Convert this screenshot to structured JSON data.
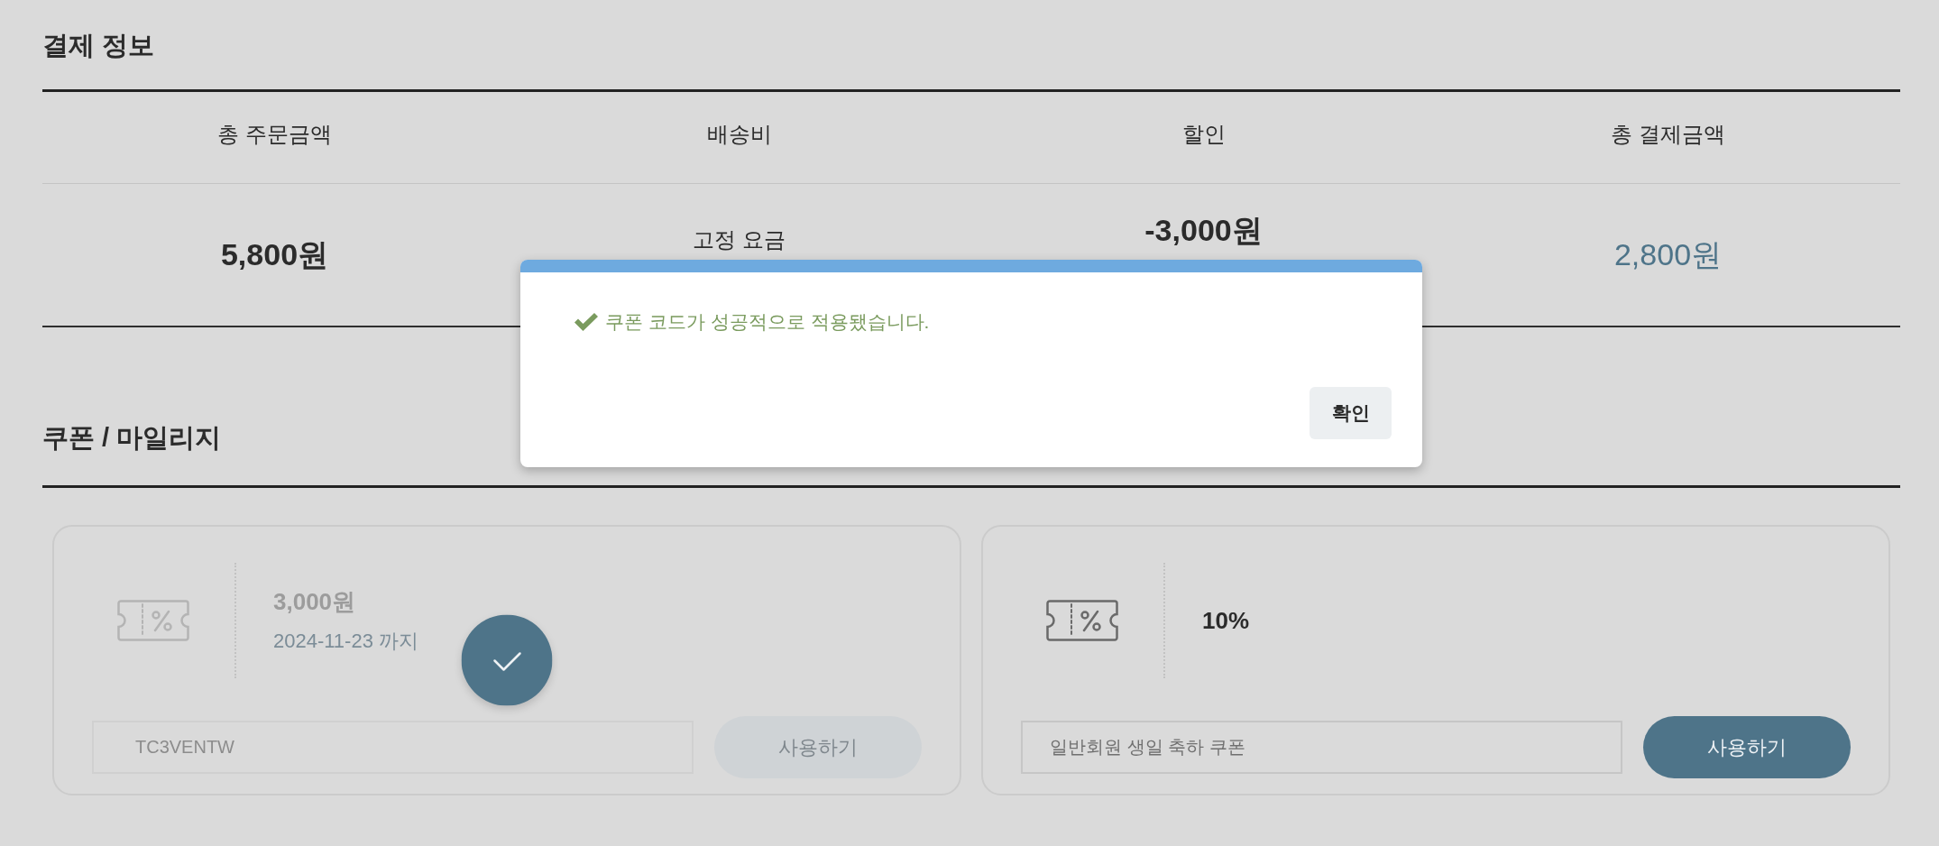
{
  "payment_info": {
    "title": "결제 정보",
    "columns": [
      {
        "kind": "order",
        "label": "총 주문금액",
        "value": "5,800원"
      },
      {
        "kind": "shipping",
        "label": "배송비",
        "value": "고정 요금"
      },
      {
        "kind": "discount",
        "label": "할인",
        "value": "-3,000원"
      },
      {
        "kind": "total",
        "label": "총 결제금액",
        "value": "2,800원"
      }
    ]
  },
  "coupons": {
    "title": "쿠폰 / 마일리지",
    "items": [
      {
        "amount": "3,000원",
        "expiry": "2024-11-23 까지",
        "field_value": "TC3VENTW",
        "button": "사용하기",
        "applied": true
      },
      {
        "amount": "10%",
        "field_value": "일반회원 생일 축하 쿠폰",
        "button": "사용하기",
        "applied": false
      }
    ]
  },
  "dialog": {
    "message": "쿠폰 코드가 성공적으로 적용됐습니다.",
    "button": "확인"
  }
}
